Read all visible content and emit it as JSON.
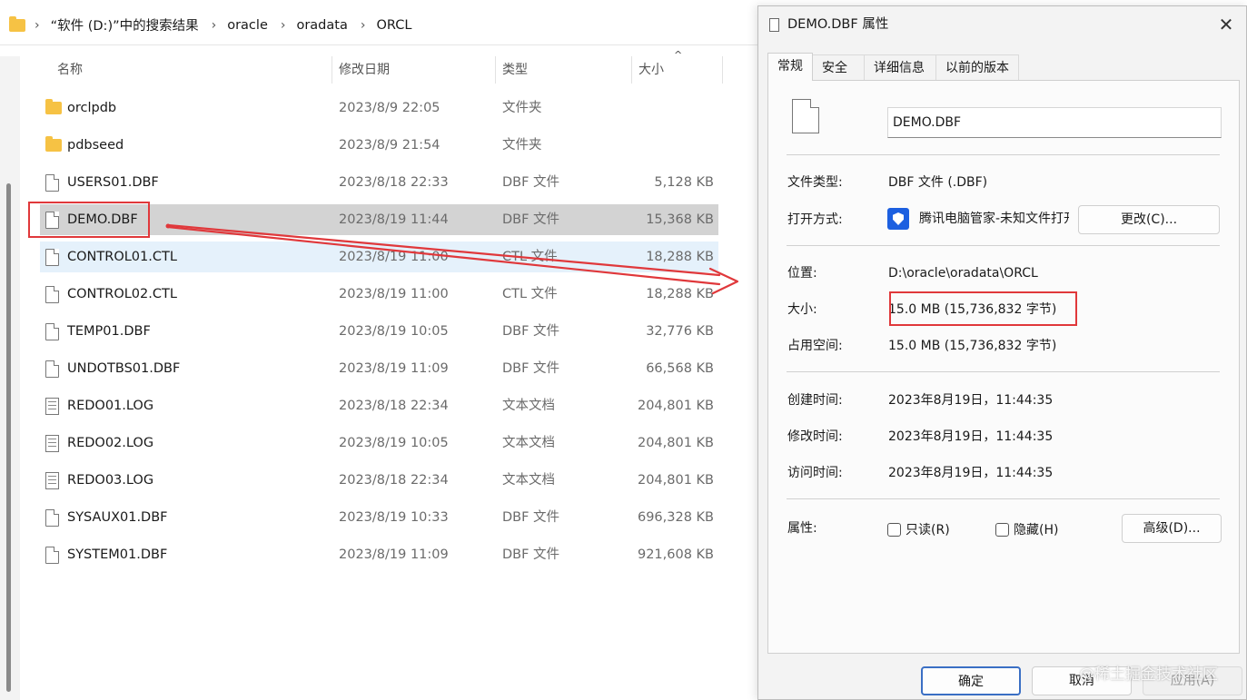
{
  "explorer": {
    "breadcrumb": [
      "“软件 (D:)”中的搜索结果",
      "oracle",
      "oradata",
      "ORCL"
    ],
    "columns": {
      "name": "名称",
      "modified": "修改日期",
      "type": "类型",
      "size": "大小"
    },
    "sort_indicator": "^",
    "files": [
      {
        "name": "orclpdb",
        "modified": "2023/8/9 22:05",
        "type": "文件夹",
        "size": "",
        "icon": "folder-icon"
      },
      {
        "name": "pdbseed",
        "modified": "2023/8/9 21:54",
        "type": "文件夹",
        "size": "",
        "icon": "folder-icon"
      },
      {
        "name": "USERS01.DBF",
        "modified": "2023/8/18 22:33",
        "type": "DBF 文件",
        "size": "5,128 KB",
        "icon": "file-icon"
      },
      {
        "name": "DEMO.DBF",
        "modified": "2023/8/19 11:44",
        "type": "DBF 文件",
        "size": "15,368 KB",
        "icon": "file-icon"
      },
      {
        "name": "CONTROL01.CTL",
        "modified": "2023/8/19 11:00",
        "type": "CTL 文件",
        "size": "18,288 KB",
        "icon": "file-icon"
      },
      {
        "name": "CONTROL02.CTL",
        "modified": "2023/8/19 11:00",
        "type": "CTL 文件",
        "size": "18,288 KB",
        "icon": "file-icon"
      },
      {
        "name": "TEMP01.DBF",
        "modified": "2023/8/19 10:05",
        "type": "DBF 文件",
        "size": "32,776 KB",
        "icon": "file-icon"
      },
      {
        "name": "UNDOTBS01.DBF",
        "modified": "2023/8/19 11:09",
        "type": "DBF 文件",
        "size": "66,568 KB",
        "icon": "file-icon"
      },
      {
        "name": "REDO01.LOG",
        "modified": "2023/8/18 22:34",
        "type": "文本文档",
        "size": "204,801 KB",
        "icon": "text-file-icon"
      },
      {
        "name": "REDO02.LOG",
        "modified": "2023/8/19 10:05",
        "type": "文本文档",
        "size": "204,801 KB",
        "icon": "text-file-icon"
      },
      {
        "name": "REDO03.LOG",
        "modified": "2023/8/18 22:34",
        "type": "文本文档",
        "size": "204,801 KB",
        "icon": "text-file-icon"
      },
      {
        "name": "SYSAUX01.DBF",
        "modified": "2023/8/19 10:33",
        "type": "DBF 文件",
        "size": "696,328 KB",
        "icon": "file-icon"
      },
      {
        "name": "SYSTEM01.DBF",
        "modified": "2023/8/19 11:09",
        "type": "DBF 文件",
        "size": "921,608 KB",
        "icon": "file-icon"
      }
    ],
    "selected_file": "DEMO.DBF",
    "hovered_file": "CONTROL01.CTL"
  },
  "dialog": {
    "title": "DEMO.DBF 属性",
    "close_glyph": "✕",
    "tabs": [
      "常规",
      "安全",
      "详细信息",
      "以前的版本"
    ],
    "active_tab": "常规",
    "filename": "DEMO.DBF",
    "file_type_label": "文件类型:",
    "file_type_value": "DBF 文件 (.DBF)",
    "open_with_label": "打开方式:",
    "open_with_app": "腾讯电脑管家-未知文件打开",
    "change_button": "更改(C)...",
    "location_label": "位置:",
    "location_value": "D:\\oracle\\oradata\\ORCL",
    "size_label": "大小:",
    "size_value": "15.0 MB (15,736,832 字节)",
    "size_on_disk_label": "占用空间:",
    "size_on_disk_value": "15.0 MB (15,736,832 字节)",
    "created_label": "创建时间:",
    "created_value": "2023年8月19日，11:44:35",
    "modified_label": "修改时间:",
    "modified_value": "2023年8月19日，11:44:35",
    "accessed_label": "访问时间:",
    "accessed_value": "2023年8月19日，11:44:35",
    "attributes_label": "属性:",
    "readonly_label": "只读(R)",
    "readonly_checked": false,
    "hidden_label": "隐藏(H)",
    "hidden_checked": false,
    "advanced_button": "高级(D)...",
    "ok_button": "确定",
    "cancel_button": "取消",
    "apply_button": "应用(A)"
  },
  "annotation": {
    "highlight_color": "#e0383b"
  },
  "watermark": "@稀土掘金技术社区"
}
